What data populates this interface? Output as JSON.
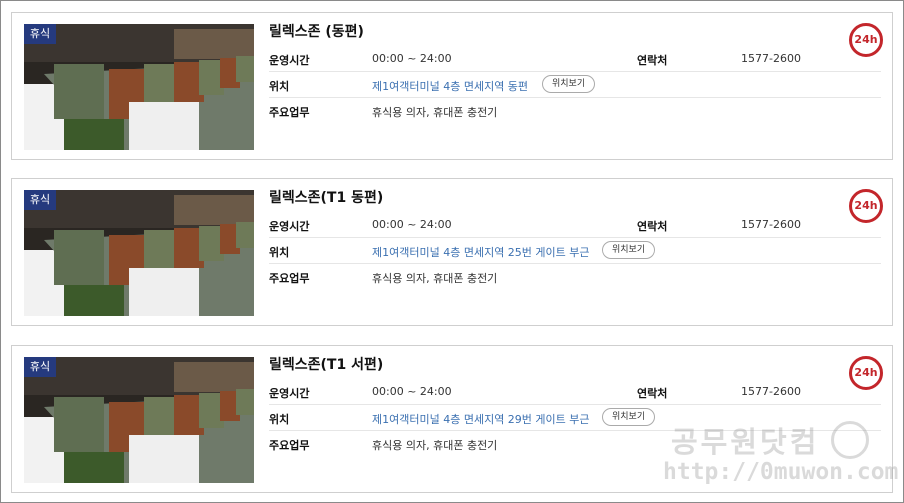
{
  "cards": [
    {
      "badge": "휴식",
      "title": "릴렉스존 (동편)",
      "hours_label": "운영시간",
      "hours_value": "00:00 ~ 24:00",
      "contact_label": "연락처",
      "contact_value": "1577-2600",
      "location_label": "위치",
      "location_value": "제1여객터미널 4층 면세지역 동편",
      "map_button": "위치보기",
      "duty_label": "주요업무",
      "duty_value": "휴식용 의자, 휴대폰 충전기",
      "open_badge": "24h"
    },
    {
      "badge": "휴식",
      "title": "릴렉스존(T1 동편)",
      "hours_label": "운영시간",
      "hours_value": "00:00 ~ 24:00",
      "contact_label": "연락처",
      "contact_value": "1577-2600",
      "location_label": "위치",
      "location_value": "제1여객터미널 4층 면세지역 25번 게이트 부근",
      "map_button": "위치보기",
      "duty_label": "주요업무",
      "duty_value": "휴식용 의자, 휴대폰 충전기",
      "open_badge": "24h"
    },
    {
      "badge": "휴식",
      "title": "릴렉스존(T1 서편)",
      "hours_label": "운영시간",
      "hours_value": "00:00 ~ 24:00",
      "contact_label": "연락처",
      "contact_value": "1577-2600",
      "location_label": "위치",
      "location_value": "제1여객터미널 4층 면세지역 29번 게이트 부근",
      "map_button": "위치보기",
      "duty_label": "주요업무",
      "duty_value": "휴식용 의자, 휴대폰 충전기",
      "open_badge": "24h"
    }
  ],
  "watermark": {
    "name": "공무원닷컴",
    "url": "http://0muwon.com"
  },
  "colors": {
    "badge": "#253a7e",
    "link": "#3a6fb0",
    "open_ring": "#c3262b"
  }
}
